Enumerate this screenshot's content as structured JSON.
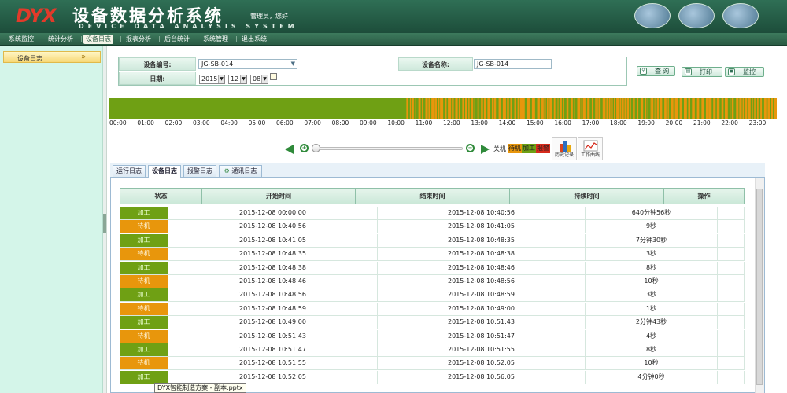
{
  "header": {
    "logo_text": "DYX",
    "title": "设备数据分析系统",
    "subtitle": "DEVICE DATA ANALYSIS SYSTEM",
    "user_greeting": "管理员，您好"
  },
  "nav": {
    "items": [
      "系统监控",
      "统计分析",
      "设备日志",
      "报表分析",
      "后台统计",
      "系统管理",
      "退出系统"
    ],
    "active_index": 2
  },
  "sidebar": {
    "items": [
      {
        "label": "设备日志",
        "chevron": "»"
      }
    ]
  },
  "filter": {
    "device_id_label": "设备编号:",
    "device_id_value": "JG-SB-014",
    "device_name_label": "设备名称:",
    "device_name_value": "JG-SB-014",
    "date_label": "日期:",
    "year": "2015",
    "month": "12",
    "day": "08",
    "query_label": "查 询",
    "print_label": "打印",
    "monitor_label": "监控"
  },
  "timeline": {
    "hours": [
      "00:00",
      "01:00",
      "02:00",
      "03:00",
      "04:00",
      "05:00",
      "06:00",
      "07:00",
      "08:00",
      "09:00",
      "10:00",
      "11:00",
      "12:00",
      "13:00",
      "14:00",
      "15:00",
      "16:00",
      "17:00",
      "18:00",
      "19:00",
      "20:00",
      "21:00",
      "22:00",
      "23:00"
    ],
    "colors": {
      "processing": "#6fa014",
      "standby": "#e8960c",
      "alarm": "#d62b1c"
    },
    "activity_start_hour": 10.68
  },
  "legend": {
    "off_label": "关机",
    "standby_label": "待机",
    "processing_label": "加工",
    "alarm_label": "报警",
    "history_label": "历史记录",
    "curve_label": "工作曲线"
  },
  "tabs": [
    {
      "label": "运行日志",
      "icon": ""
    },
    {
      "label": "设备日志",
      "icon": ""
    },
    {
      "label": "报警日志",
      "icon": ""
    },
    {
      "label": "通讯日志",
      "icon": "gear-icon"
    }
  ],
  "active_tab": 1,
  "table": {
    "columns": [
      "状态",
      "开始时间",
      "结束时间",
      "持续时间",
      "操作"
    ],
    "rows": [
      {
        "state": "加工",
        "start": "2015-12-08 00:00:00",
        "end": "2015-12-08 10:40:56",
        "duration": "640分钟56秒"
      },
      {
        "state": "待机",
        "start": "2015-12-08 10:40:56",
        "end": "2015-12-08 10:41:05",
        "duration": "9秒"
      },
      {
        "state": "加工",
        "start": "2015-12-08 10:41:05",
        "end": "2015-12-08 10:48:35",
        "duration": "7分钟30秒"
      },
      {
        "state": "待机",
        "start": "2015-12-08 10:48:35",
        "end": "2015-12-08 10:48:38",
        "duration": "3秒"
      },
      {
        "state": "加工",
        "start": "2015-12-08 10:48:38",
        "end": "2015-12-08 10:48:46",
        "duration": "8秒"
      },
      {
        "state": "待机",
        "start": "2015-12-08 10:48:46",
        "end": "2015-12-08 10:48:56",
        "duration": "10秒"
      },
      {
        "state": "加工",
        "start": "2015-12-08 10:48:56",
        "end": "2015-12-08 10:48:59",
        "duration": "3秒"
      },
      {
        "state": "待机",
        "start": "2015-12-08 10:48:59",
        "end": "2015-12-08 10:49:00",
        "duration": "1秒"
      },
      {
        "state": "加工",
        "start": "2015-12-08 10:49:00",
        "end": "2015-12-08 10:51:43",
        "duration": "2分钟43秒"
      },
      {
        "state": "待机",
        "start": "2015-12-08 10:51:43",
        "end": "2015-12-08 10:51:47",
        "duration": "4秒"
      },
      {
        "state": "加工",
        "start": "2015-12-08 10:51:47",
        "end": "2015-12-08 10:51:55",
        "duration": "8秒"
      },
      {
        "state": "待机",
        "start": "2015-12-08 10:51:55",
        "end": "2015-12-08 10:52:05",
        "duration": "10秒"
      },
      {
        "state": "加工",
        "start": "2015-12-08 10:52:05",
        "end": "2015-12-08 10:56:05",
        "duration": "4分钟0秒"
      }
    ]
  },
  "tooltip": "DYX智能制造方案 - 副本.pptx"
}
